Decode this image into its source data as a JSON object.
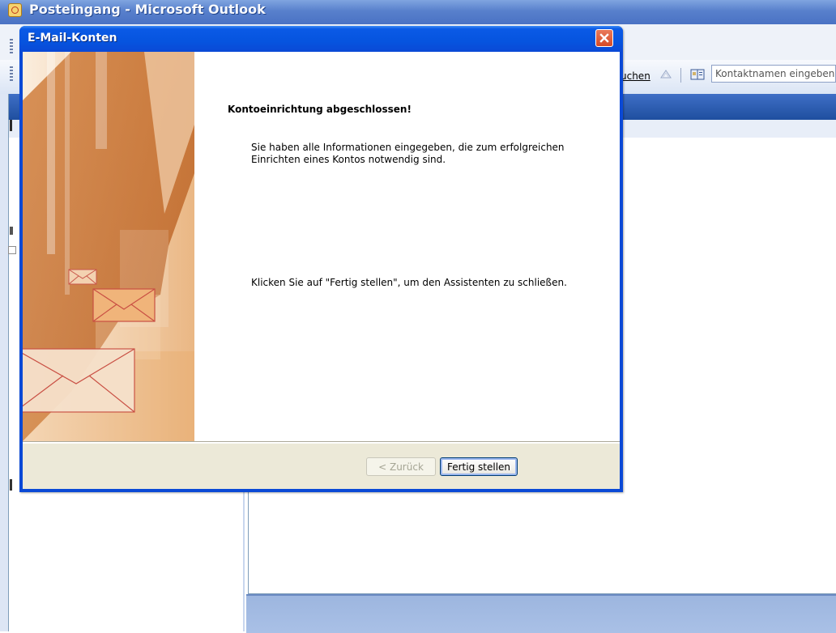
{
  "background_window": {
    "title": "Posteingang - Microsoft Outlook",
    "toolbar": {
      "search_label": "uchen",
      "contact_search_placeholder": "Kontaktnamen eingeben"
    }
  },
  "dialog": {
    "title": "E-Mail-Konten",
    "heading": "Kontoeinrichtung abgeschlossen!",
    "paragraph1": "Sie haben alle Informationen eingegeben, die zum erfolgreichen Einrichten eines Kontos notwendig sind.",
    "paragraph2": "Klicken Sie auf \"Fertig stellen\", um den Assistenten zu schließen.",
    "buttons": {
      "back": "< Zurück",
      "finish": "Fertig stellen"
    },
    "icons": [
      "close-icon",
      "envelope-icon"
    ]
  },
  "colors": {
    "titlebar_blue": "#0a49d6",
    "close_red": "#d64a26",
    "dialog_face": "#ece9d8"
  }
}
